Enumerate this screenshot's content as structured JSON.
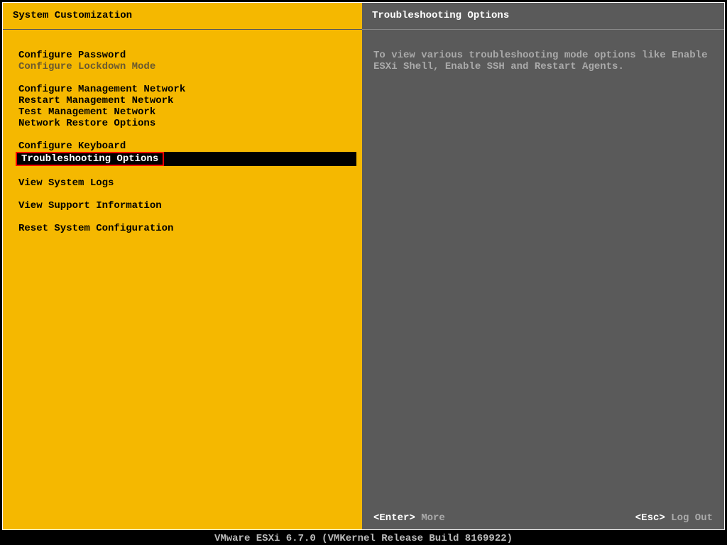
{
  "left": {
    "title": "System Customization",
    "groups": [
      [
        {
          "label": "Configure Password",
          "state": "normal"
        },
        {
          "label": "Configure Lockdown Mode",
          "state": "disabled"
        }
      ],
      [
        {
          "label": "Configure Management Network",
          "state": "normal"
        },
        {
          "label": "Restart Management Network",
          "state": "normal"
        },
        {
          "label": "Test Management Network",
          "state": "normal"
        },
        {
          "label": "Network Restore Options",
          "state": "normal"
        }
      ],
      [
        {
          "label": "Configure Keyboard",
          "state": "normal"
        },
        {
          "label": "Troubleshooting Options",
          "state": "selected"
        }
      ],
      [
        {
          "label": "View System Logs",
          "state": "normal"
        }
      ],
      [
        {
          "label": "View Support Information",
          "state": "normal"
        }
      ],
      [
        {
          "label": "Reset System Configuration",
          "state": "normal"
        }
      ]
    ]
  },
  "right": {
    "title": "Troubleshooting Options",
    "description": "To view various troubleshooting mode options like Enable ESXi Shell, Enable SSH and Restart Agents."
  },
  "footer": {
    "enter_key": "<Enter>",
    "enter_label": " More",
    "esc_key": "<Esc>",
    "esc_label": " Log Out"
  },
  "status_bar": "VMware ESXi 6.7.0 (VMKernel Release Build 8169922)"
}
